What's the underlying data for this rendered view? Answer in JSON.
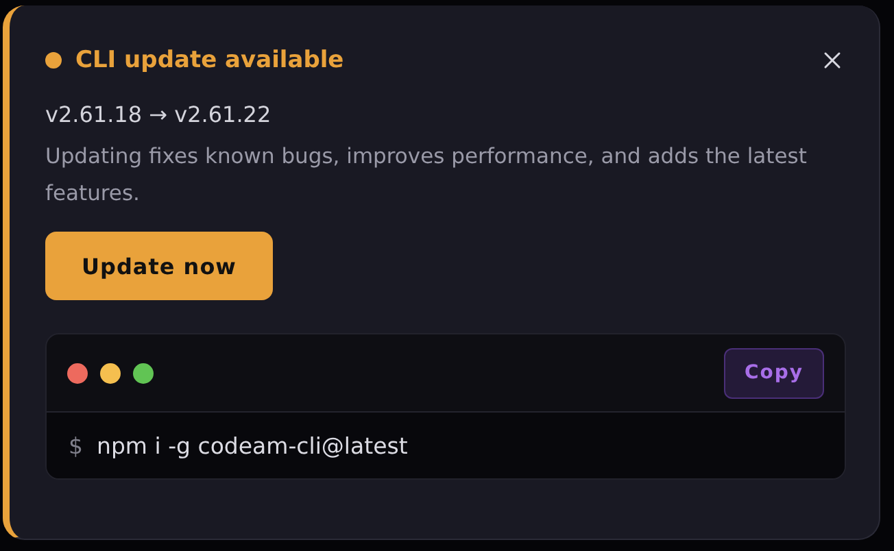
{
  "notice": {
    "title": "CLI update available",
    "versions": "v2.61.18 → v2.61.22",
    "description": "Updating fixes known bugs, improves performance, and adds the latest features.",
    "primary_button": "Update now"
  },
  "terminal": {
    "window_dots": [
      {
        "color": "#ed6a5e"
      },
      {
        "color": "#f5bf4f"
      },
      {
        "color": "#61c454"
      }
    ],
    "copy_button": "Copy",
    "prompt": "$",
    "command": "npm i -g codeam-cli@latest"
  }
}
